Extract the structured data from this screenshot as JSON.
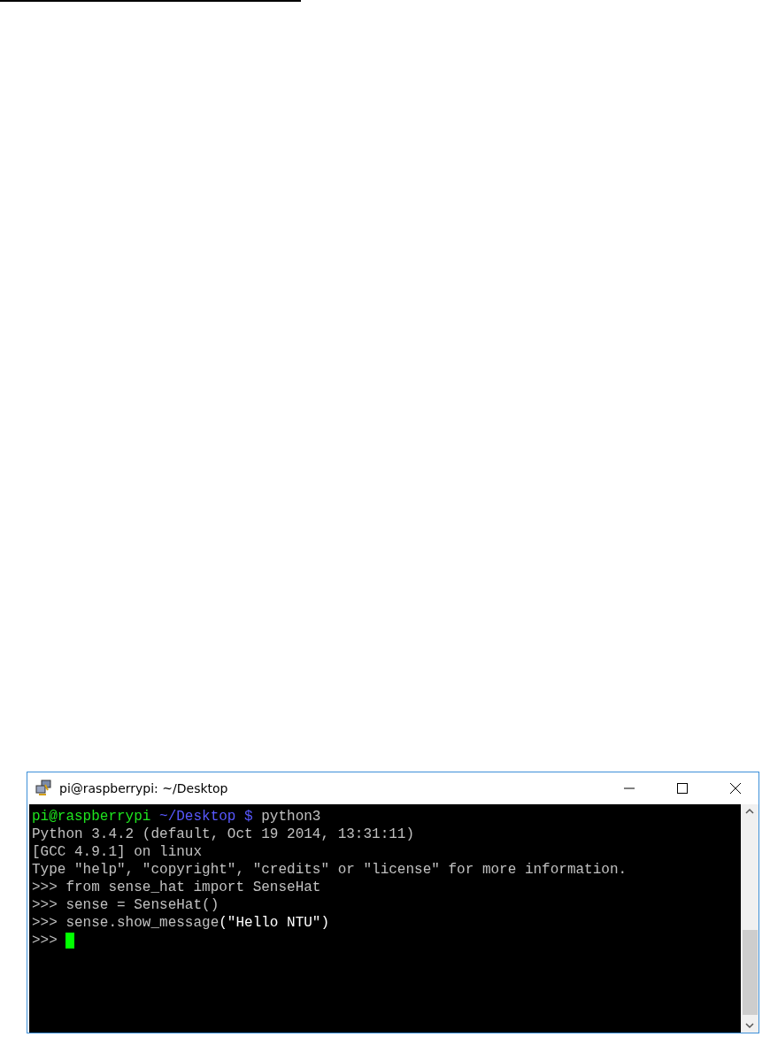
{
  "window": {
    "title": "pi@raspberrypi: ~/Desktop"
  },
  "terminal": {
    "lines": [
      {
        "segments": [
          {
            "text": "pi@raspberrypi",
            "color": "#1ee51e"
          },
          {
            "text": " ~/Desktop $",
            "color": "#5858ff"
          },
          {
            "text": " python3",
            "color": "#c0c0c0"
          }
        ]
      },
      {
        "segments": [
          {
            "text": "Python 3.4.2 (default, Oct 19 2014, 13:31:11)",
            "color": "#c0c0c0"
          }
        ]
      },
      {
        "segments": [
          {
            "text": "[GCC 4.9.1] on linux",
            "color": "#c0c0c0"
          }
        ]
      },
      {
        "segments": [
          {
            "text": "Type \"help\", \"copyright\", \"credits\" or \"license\" for more information.",
            "color": "#c0c0c0"
          }
        ]
      },
      {
        "segments": [
          {
            "text": ">>> from sense_hat import SenseHat",
            "color": "#c0c0c0"
          }
        ]
      },
      {
        "segments": [
          {
            "text": ">>> sense = SenseHat()",
            "color": "#c0c0c0"
          }
        ]
      },
      {
        "segments": [
          {
            "text": ">>> sense.show_message",
            "color": "#c0c0c0"
          },
          {
            "text": "(\"Hello NTU\")",
            "color": "#ffffff"
          }
        ]
      },
      {
        "segments": [
          {
            "text": ">>> ",
            "color": "#c0c0c0"
          }
        ],
        "cursor": true
      }
    ]
  }
}
